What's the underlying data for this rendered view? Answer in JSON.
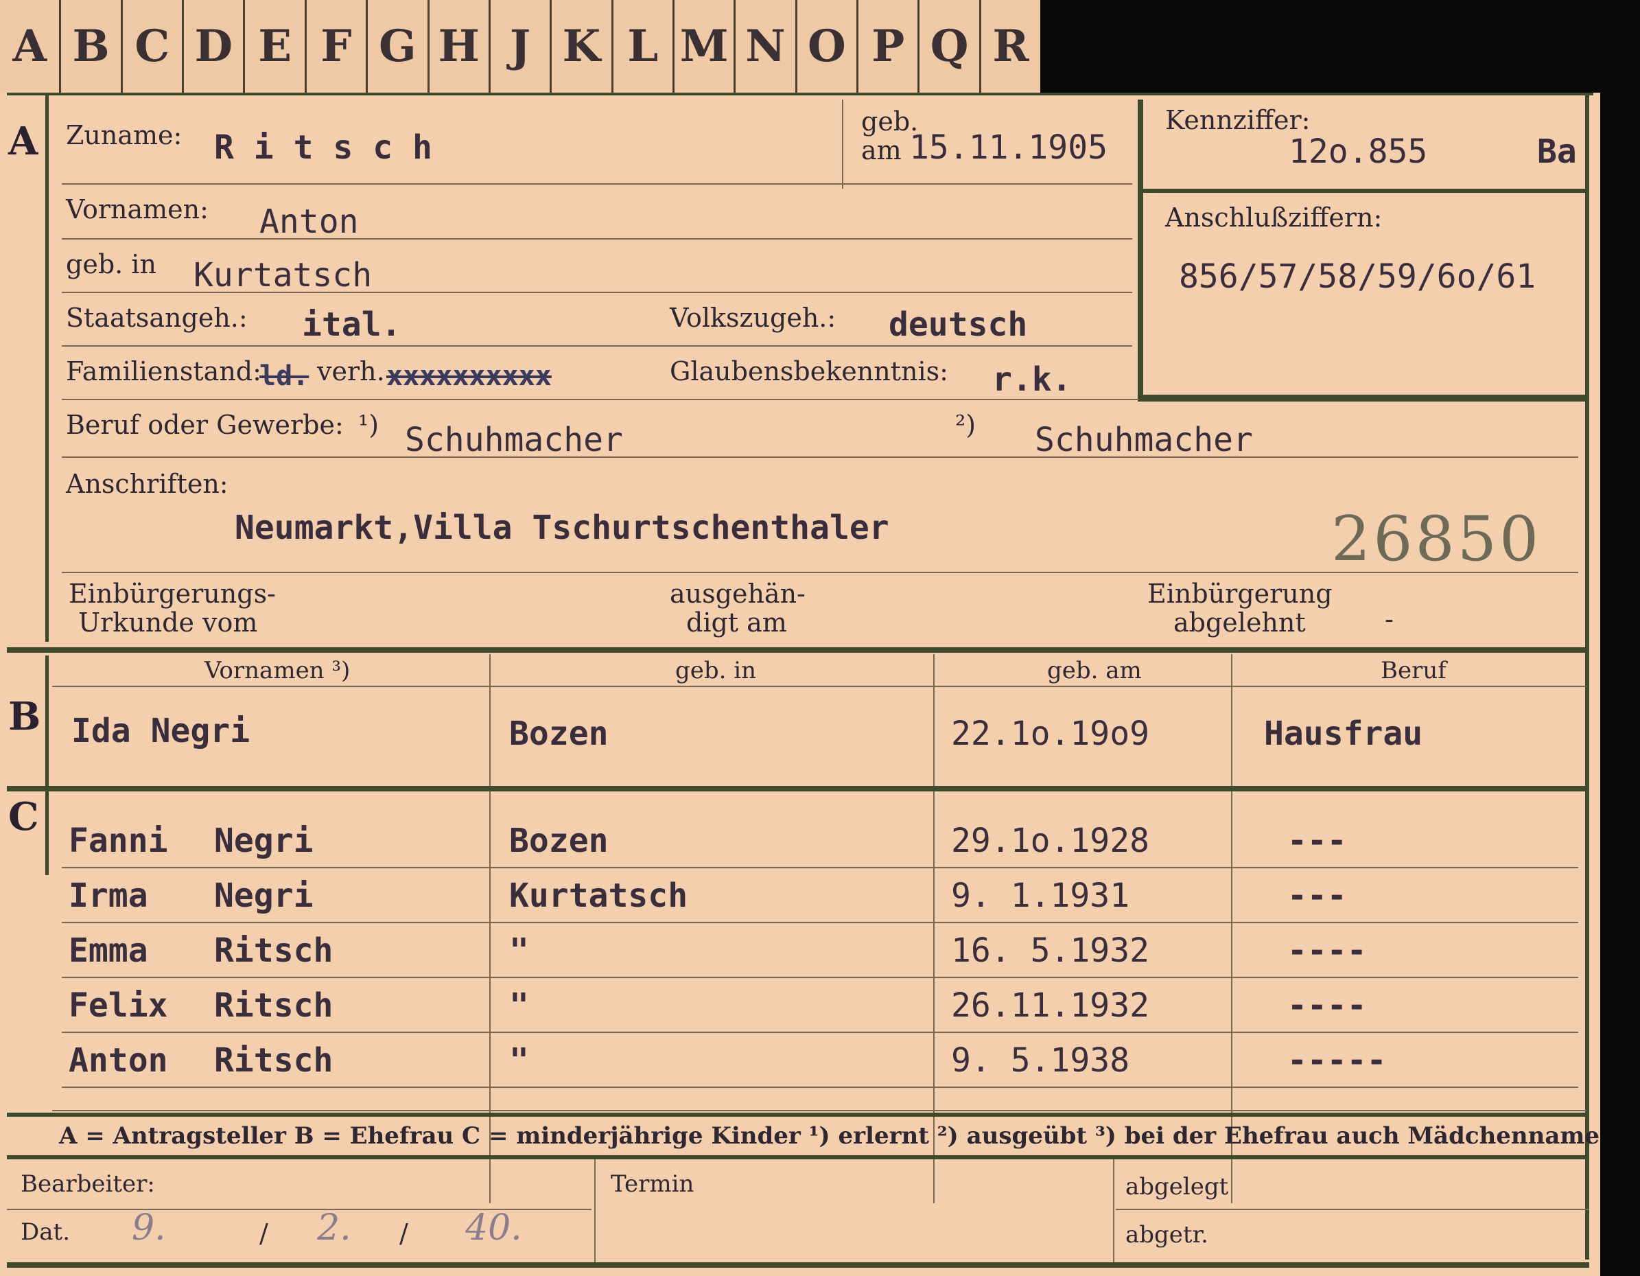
{
  "tabs": [
    "A",
    "B",
    "C",
    "D",
    "E",
    "F",
    "G",
    "H",
    "J",
    "K",
    "L",
    "M",
    "N",
    "O",
    "P",
    "Q",
    "R"
  ],
  "section_a": {
    "letter": "A",
    "zuname_label": "Zuname:",
    "zuname": "R i t s c h",
    "geb_label_1": "geb.",
    "geb_label_2": "am",
    "geb_am": "15.11.1905",
    "kennziffer_label": "Kennziffer:",
    "kennziffer": "12o.855",
    "kennziffer_suffix": "Ba",
    "vornamen_label": "Vornamen:",
    "vornamen": "Anton",
    "anschluss_label": "Anschlußziffern:",
    "anschluss": "856/57/58/59/6o/61",
    "geb_in_label": "geb. in",
    "geb_in": "Kurtatsch",
    "staat_label": "Staatsangeh.:",
    "staat": "ital.",
    "volk_label": "Volkszugeh.:",
    "volk": "deutsch",
    "familie_label": "Familienstand:",
    "familie_struck_1": "ld.",
    "familie_value": "verh.",
    "familie_struck_2": "xxxxxxxxxx",
    "glauben_label": "Glaubensbekenntnis:",
    "glauben": "r.k.",
    "beruf_label": "Beruf oder Gewerbe:",
    "beruf_marker_1": "¹)",
    "beruf_1": "Schuhmacher",
    "beruf_marker_2": "²)",
    "beruf_2": "Schuhmacher",
    "anschriften_label": "Anschriften:",
    "anschrift": "Neumarkt,Villa Tschurtschenthaler",
    "stamp_number": "26850",
    "einb_urkunde_1": "Einbürgerungs-",
    "einb_urkunde_2": "Urkunde vom",
    "ausgehaend_1": "ausgehän-",
    "ausgehaend_2": "digt am",
    "einb_abgelehnt_1": "Einbürgerung",
    "einb_abgelehnt_2": "abgelehnt",
    "einb_abgelehnt_value": "-"
  },
  "columns": {
    "vornamen": "Vornamen ³)",
    "geb_in": "geb. in",
    "geb_am": "geb. am",
    "beruf": "Beruf"
  },
  "section_b": {
    "letter": "B",
    "vornamen": "Ida Negri",
    "geb_in": "Bozen",
    "geb_am": "22.1o.19o9",
    "beruf": "Hausfrau"
  },
  "section_c": {
    "letter": "C",
    "rows": [
      {
        "first": "Fanni",
        "last": "Negri",
        "geb_in": "Bozen",
        "geb_am": "29.1o.1928",
        "beruf": "---"
      },
      {
        "first": "Irma",
        "last": "Negri",
        "geb_in": "Kurtatsch",
        "geb_am": "9. 1.1931",
        "beruf": "---"
      },
      {
        "first": "Emma",
        "last": "Ritsch",
        "geb_in": "\"",
        "geb_am": "16. 5.1932",
        "beruf": "----"
      },
      {
        "first": "Felix",
        "last": "Ritsch",
        "geb_in": "\"",
        "geb_am": "26.11.1932",
        "beruf": "----"
      },
      {
        "first": "Anton",
        "last": "Ritsch",
        "geb_in": "\"",
        "geb_am": "9. 5.1938",
        "beruf": "-----"
      }
    ]
  },
  "legend": "A = Antragsteller   B = Ehefrau   C = minderjährige Kinder   ¹) erlernt   ²) ausgeübt   ³) bei der Ehefrau auch Mädchenname",
  "footer": {
    "bearbeiter_label": "Bearbeiter:",
    "dat_label": "Dat.",
    "dat_day": "9.",
    "dat_sep": "/",
    "dat_month": "2.",
    "dat_year": "40.",
    "termin_label": "Termin",
    "abgelegt_label": "abgelegt",
    "abgetr_label": "abgetr."
  }
}
